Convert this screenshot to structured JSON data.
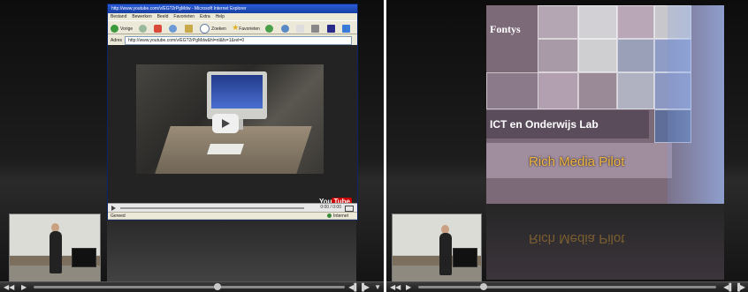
{
  "left_player": {
    "browser": {
      "title": "http://www.youtube.com/v/EG?2rPgMdw - Microsoft Internet Explorer",
      "menu": [
        "Bestand",
        "Bewerken",
        "Beeld",
        "Favorieten",
        "Extra",
        "Help"
      ],
      "toolbar": {
        "back": "Vorige",
        "search": "Zoeken",
        "favorites": "Favorieten"
      },
      "address_label": "Adres",
      "address_value": "http://www.youtube.com/v/EG?2rPgMdw&hl=nl&fs=1&rel=0",
      "status_left": "Gereed",
      "status_zone": "Internet"
    },
    "youtube": {
      "logo_you": "You",
      "logo_tube": "Tube",
      "time": "0:00 / 0:00"
    },
    "controls": {
      "rewind_icon": "rewind-icon",
      "play_icon": "play-icon",
      "progress": 0.59
    }
  },
  "right_player": {
    "slide": {
      "brand": "Fontys",
      "heading": "ICT en Onderwijs Lab",
      "subtitle": "Rich Media Pilot"
    },
    "controls": {
      "rewind_icon": "rewind-icon",
      "play_icon": "play-icon",
      "progress": 0.22
    }
  }
}
